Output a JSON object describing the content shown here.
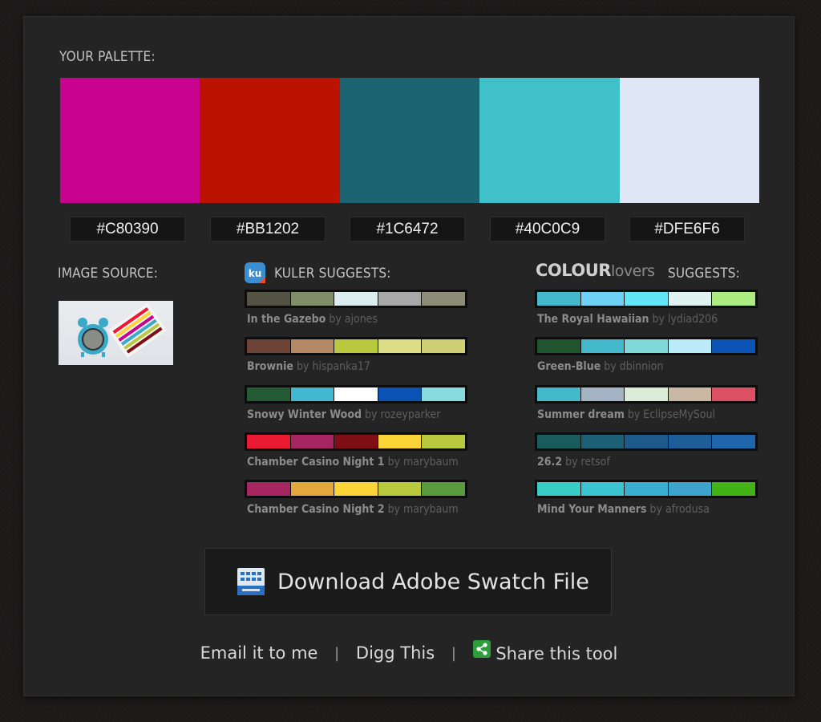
{
  "labels": {
    "your_palette": "YOUR PALETTE:",
    "image_source": "IMAGE SOURCE:",
    "kuler": "KULER SUGGESTS:",
    "colourlovers_logo_a": "COLOUR",
    "colourlovers_logo_b": "lovers",
    "colourlovers": "SUGGESTS:"
  },
  "palette": [
    {
      "color": "#C80390",
      "hex": "#C80390"
    },
    {
      "color": "#BB1202",
      "hex": "#BB1202"
    },
    {
      "color": "#1C6472",
      "hex": "#1C6472"
    },
    {
      "color": "#40C0C9",
      "hex": "#40C0C9"
    },
    {
      "color": "#DFE6F6",
      "hex": "#DFE6F6"
    }
  ],
  "kuler": [
    {
      "name": "In the Gazebo",
      "by": "by ajones",
      "colors": [
        "#525343",
        "#7f8d69",
        "#dcedef",
        "#a8a8a8",
        "#8c8c78"
      ]
    },
    {
      "name": "Brownie",
      "by": "by hispanka17",
      "colors": [
        "#6b4436",
        "#b38967",
        "#b8c93e",
        "#dcdd84",
        "#d0cf76"
      ]
    },
    {
      "name": "Snowy Winter Wood",
      "by": "by rozeyparker",
      "colors": [
        "#245a34",
        "#41b8cf",
        "#ffffff",
        "#0b52b5",
        "#87dbdf"
      ]
    },
    {
      "name": "Chamber Casino Night 1",
      "by": "by marybaum",
      "colors": [
        "#ea1a33",
        "#a52660",
        "#7d0f15",
        "#fbd438",
        "#b8c93e"
      ]
    },
    {
      "name": "Chamber Casino Night 2",
      "by": "by marybaum",
      "colors": [
        "#a52660",
        "#e3a83c",
        "#fbd438",
        "#b8c93e",
        "#5a9b3f"
      ]
    }
  ],
  "colourlovers": [
    {
      "name": "The Royal Hawaiian",
      "by": "by lydiad206",
      "colors": [
        "#43b9cb",
        "#6fd2f5",
        "#61e6f8",
        "#dff2f0",
        "#acec80"
      ]
    },
    {
      "name": "Green-Blue",
      "by": "by dbinnion",
      "colors": [
        "#20542e",
        "#43b9cb",
        "#7fd8d8",
        "#bbebf8",
        "#0b52b5"
      ]
    },
    {
      "name": "Summer dream",
      "by": "by EclipseMySoul",
      "colors": [
        "#43b9cb",
        "#a5b4c5",
        "#dbedd7",
        "#c8b7a2",
        "#dc5063"
      ]
    },
    {
      "name": "26.2",
      "by": "by retsof",
      "colors": [
        "#1a5b5d",
        "#1d5f74",
        "#1d5a8b",
        "#1f5d9a",
        "#2066ad"
      ]
    },
    {
      "name": "Mind Your Manners",
      "by": "by afrodusa",
      "colors": [
        "#39ccc4",
        "#3cc3d1",
        "#39aece",
        "#3fa4cc",
        "#43b217"
      ]
    }
  ],
  "download": {
    "label": "Download Adobe Swatch File",
    "icon": "swatch-file-icon"
  },
  "footer": {
    "email": "Email it to me",
    "sep1": "|",
    "digg": "Digg This",
    "sep2": "|",
    "share": "Share this tool",
    "share_icon": "share-icon"
  }
}
